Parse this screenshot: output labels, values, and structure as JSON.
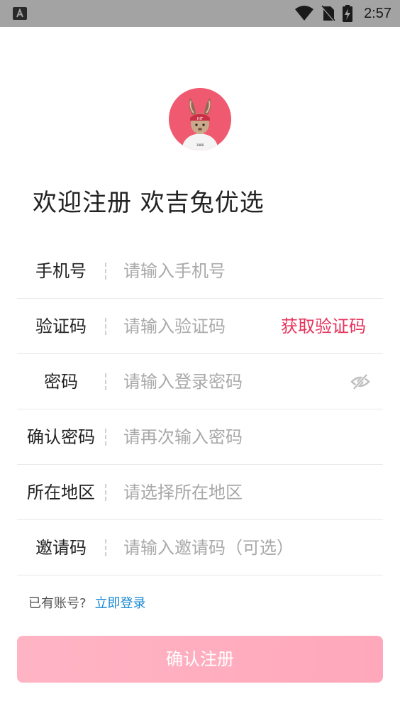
{
  "status_bar": {
    "time": "2:57",
    "icons": [
      "app-notification-icon",
      "wifi-icon",
      "no-sim-icon",
      "battery-charging-icon"
    ],
    "background": "#a3a3a3"
  },
  "header": {
    "avatar_icon": "rabbit-mascot-logo",
    "welcome_text": "欢迎注册 欢吉兔优选"
  },
  "form": {
    "fields": [
      {
        "label": "手机号",
        "placeholder": "请输入手机号",
        "value": ""
      },
      {
        "label": "验证码",
        "placeholder": "请输入验证码",
        "value": "",
        "action_label": "获取验证码"
      },
      {
        "label": "密码",
        "placeholder": "请输入登录密码",
        "value": "",
        "action_icon": "eye-hidden-icon"
      },
      {
        "label": "确认密码",
        "placeholder": "请再次输入密码",
        "value": ""
      },
      {
        "label": "所在地区",
        "placeholder": "请选择所在地区",
        "value": ""
      },
      {
        "label": "邀请码",
        "placeholder": "请输入邀请码（可选）",
        "value": ""
      }
    ]
  },
  "login_prompt": {
    "hint": "已有账号?",
    "link": "立即登录"
  },
  "submit_label": "确认注册",
  "colors": {
    "accent": "#e8305a",
    "link": "#1787d6",
    "button": "#ffafc0"
  }
}
